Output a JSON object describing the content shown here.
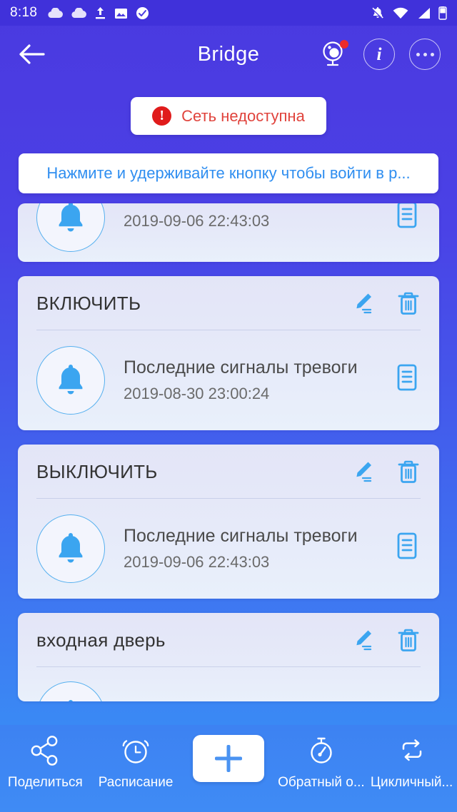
{
  "status_bar": {
    "time": "8:18",
    "left_icons": [
      "cloud-icon",
      "cloud-icon",
      "upload-icon",
      "image-icon",
      "check-circle-icon"
    ],
    "right_icons": [
      "bell-off-icon",
      "wifi-icon",
      "cellular-signal-icon",
      "battery-icon"
    ]
  },
  "header": {
    "back_label": "back-arrow",
    "title": "Bridge",
    "actions": [
      {
        "name": "camera-icon",
        "badge": true
      },
      {
        "name": "info-icon",
        "glyph": "i"
      },
      {
        "name": "more-options-icon"
      }
    ]
  },
  "network_banner": {
    "icon": "error-icon",
    "glyph": "!",
    "text": "Сеть недоступна"
  },
  "hint": {
    "text": "Нажмите и удерживайте кнопку чтобы войти в р..."
  },
  "cards": [
    {
      "clipped": "top",
      "title": "",
      "alarm_label": "",
      "alarm_time": "2019-09-06 22:43:03"
    },
    {
      "clipped": "none",
      "title": "ВКЛЮЧИТЬ",
      "alarm_label": "Последние сигналы тревоги",
      "alarm_time": "2019-08-30 23:00:24"
    },
    {
      "clipped": "none",
      "title": "ВЫКЛЮЧИТЬ",
      "alarm_label": "Последние сигналы тревоги",
      "alarm_time": "2019-09-06 22:43:03"
    },
    {
      "clipped": "bottom",
      "title": "входная дверь",
      "alarm_label": "",
      "alarm_time": ""
    }
  ],
  "card_icons": {
    "edit": "edit-pencil-icon",
    "delete": "trash-icon",
    "bell": "bell-icon",
    "log": "log-document-icon"
  },
  "bottom_nav": [
    {
      "icon": "share-icon",
      "label": "Поделиться"
    },
    {
      "icon": "alarm-clock-icon",
      "label": "Расписание"
    },
    {
      "icon": "plus-icon",
      "label": ""
    },
    {
      "icon": "stopwatch-icon",
      "label": "Обратный о..."
    },
    {
      "icon": "loop-icon",
      "label": "Цикличный..."
    }
  ],
  "colors": {
    "accent_blue": "#3ba5f0",
    "bg_top": "#4a3ae0",
    "bg_bottom": "#3b8ff5",
    "error_red": "#e01b1b",
    "link_blue": "#2f8ef0"
  }
}
